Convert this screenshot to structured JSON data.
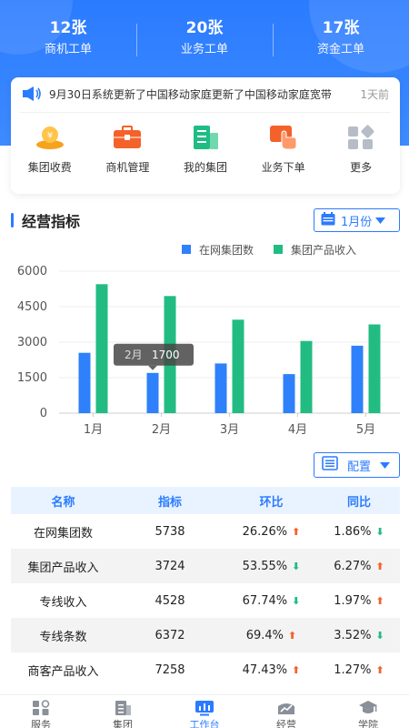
{
  "stats": [
    {
      "value": "12张",
      "label": "商机工单"
    },
    {
      "value": "20张",
      "label": "业务工单"
    },
    {
      "value": "17张",
      "label": "资金工单"
    }
  ],
  "notice": {
    "icon": "speaker-icon",
    "text": "9月30日系统更新了中国移动家庭更新了中国移动家庭宽带",
    "time": "1天前"
  },
  "quick_actions": [
    {
      "label": "集团收费",
      "icon": "collect-fee-icon",
      "color": "#f7a21b"
    },
    {
      "label": "商机管理",
      "icon": "briefcase-icon",
      "color": "#f4622b"
    },
    {
      "label": "我的集团",
      "icon": "building-icon",
      "color": "#1fbc84"
    },
    {
      "label": "业务下单",
      "icon": "touch-order-icon",
      "color": "#f4622b"
    },
    {
      "label": "更多",
      "icon": "more-grid-icon",
      "color": "#b6bdc6"
    }
  ],
  "section": {
    "title": "经营指标",
    "month_selector": "1月份"
  },
  "legend": [
    {
      "label": "在网集团数",
      "color": "#2f80fb"
    },
    {
      "label": "集团产品收入",
      "color": "#22bc82"
    }
  ],
  "chart_data": {
    "type": "bar",
    "categories": [
      "1月",
      "2月",
      "3月",
      "4月",
      "5月"
    ],
    "series": [
      {
        "name": "在网集团数",
        "values": [
          2550,
          1700,
          2100,
          1650,
          2850
        ]
      },
      {
        "name": "集团产品收入",
        "values": [
          5450,
          4950,
          3950,
          3050,
          3750
        ]
      }
    ],
    "ylim": [
      0,
      6000
    ],
    "yticks": [
      "0",
      "1500",
      "3000",
      "4500",
      "6000"
    ],
    "grid": true,
    "legend_position": "top-right",
    "tooltip": {
      "category": "2月",
      "value": "1700"
    }
  },
  "config_button": "配置",
  "table": {
    "headers": [
      "名称",
      "指标",
      "环比",
      "同比"
    ],
    "rows": [
      {
        "name": "在网集团数",
        "value": "5738",
        "mom": "26.26%",
        "mom_dir": "up",
        "yoy": "1.86%",
        "yoy_dir": "down"
      },
      {
        "name": "集团产品收入",
        "value": "3724",
        "mom": "53.55%",
        "mom_dir": "down",
        "yoy": "6.27%",
        "yoy_dir": "up"
      },
      {
        "name": "专线收入",
        "value": "4528",
        "mom": "67.74%",
        "mom_dir": "down",
        "yoy": "1.97%",
        "yoy_dir": "up"
      },
      {
        "name": "专线条数",
        "value": "6372",
        "mom": "69.4%",
        "mom_dir": "up",
        "yoy": "3.52%",
        "yoy_dir": "down"
      },
      {
        "name": "商客产品收入",
        "value": "7258",
        "mom": "47.43%",
        "mom_dir": "up",
        "yoy": "1.27%",
        "yoy_dir": "up"
      }
    ]
  },
  "colors": {
    "primary": "#2b7bff",
    "up": "#f4622b",
    "down": "#1fbc84"
  },
  "tabs": [
    {
      "label": "服务",
      "icon": "service-icon",
      "active": false
    },
    {
      "label": "集团",
      "icon": "group-icon",
      "active": false
    },
    {
      "label": "工作台",
      "icon": "workbench-icon",
      "active": true
    },
    {
      "label": "经营",
      "icon": "business-icon",
      "active": false
    },
    {
      "label": "学院",
      "icon": "academy-icon",
      "active": false
    }
  ]
}
